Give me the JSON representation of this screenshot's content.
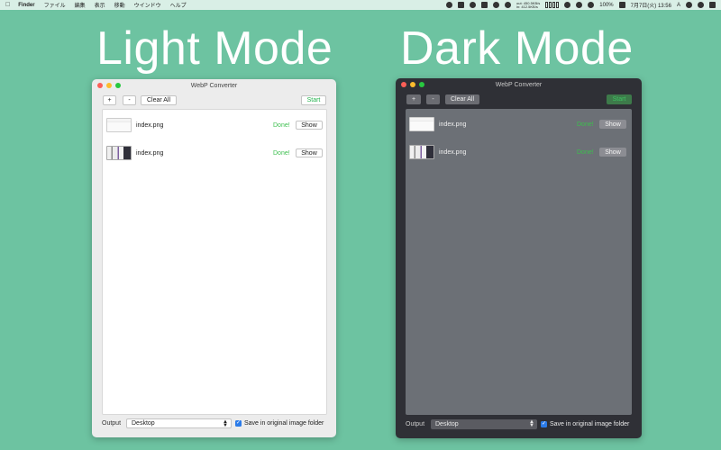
{
  "menubar": {
    "items": [
      "Finder",
      "ファイル",
      "編集",
      "表示",
      "移動",
      "ウインドウ",
      "ヘルプ"
    ],
    "net_up_label": "out:",
    "net_up": "450.5KB/s",
    "net_down_label": "in:",
    "net_down": "412.5KB/s",
    "battery": "100%",
    "clock": "7月7日(火) 13:56",
    "input_method": "A"
  },
  "headings": {
    "light": "Light Mode",
    "dark": "Dark Mode"
  },
  "window": {
    "title": "WebP Converter",
    "add_label": "+",
    "remove_label": "-",
    "clear_label": "Clear All",
    "start_label": "Start",
    "files": [
      {
        "name": "index.png",
        "status": "Done!",
        "action": "Show"
      },
      {
        "name": "index.png",
        "status": "Done!",
        "action": "Show"
      }
    ],
    "output_label": "Output",
    "output_value": "Desktop",
    "save_label": "Save in original image folder",
    "save_checked": true
  },
  "colors": {
    "background": "#6dc3a1",
    "done": "#3cbf4e",
    "checkbox": "#2b7be8"
  }
}
